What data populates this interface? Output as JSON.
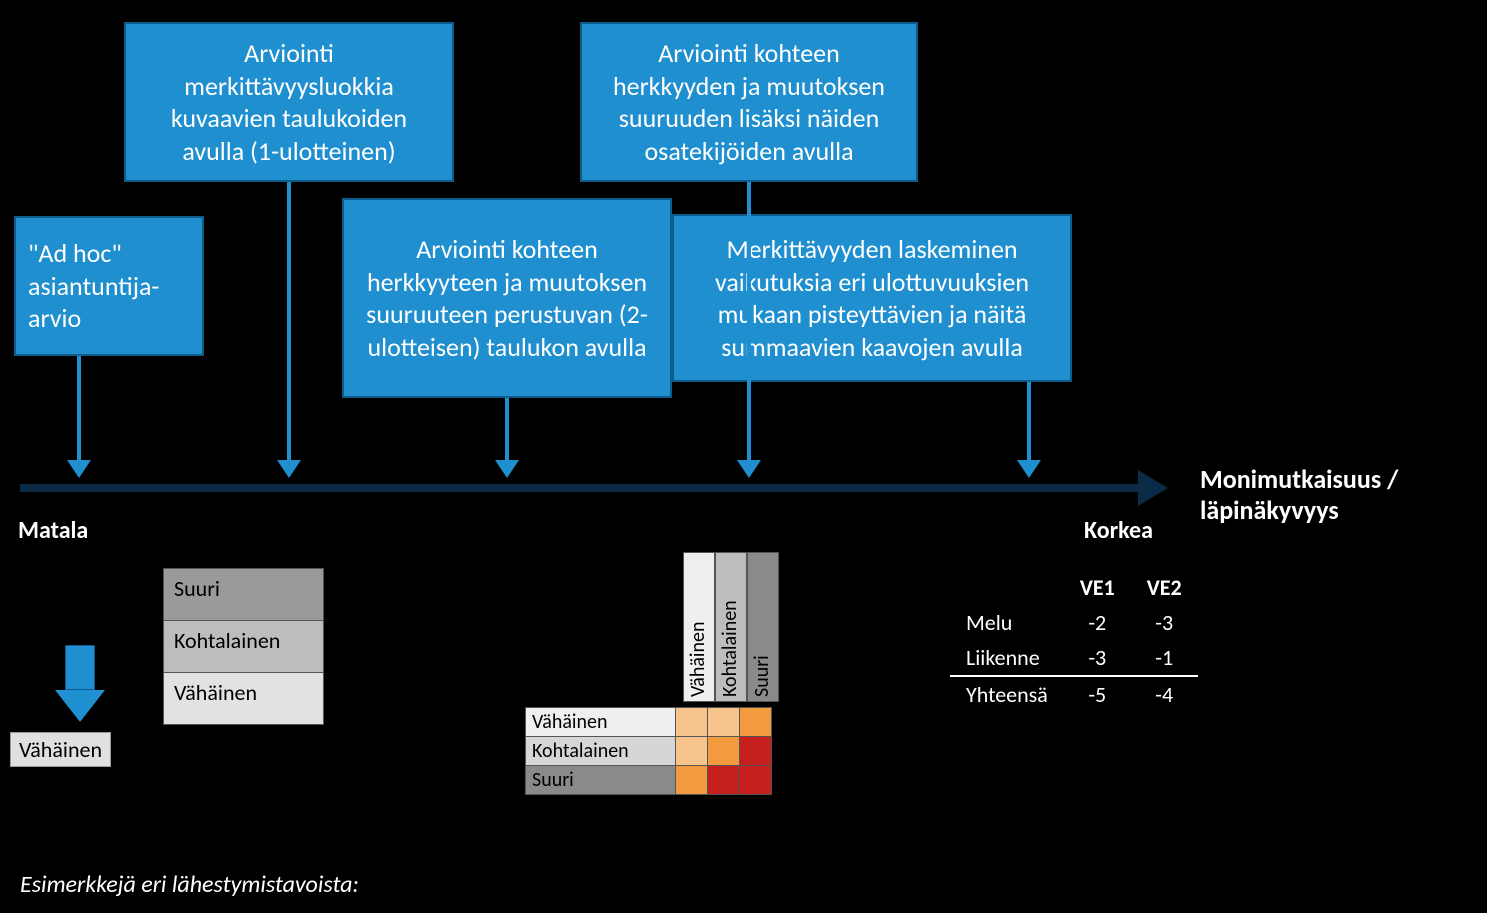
{
  "axis": {
    "low": "Matala",
    "high": "Korkea",
    "complexity_line1": "Monimutkaisuus /",
    "complexity_line2": "läpinäkyvyys"
  },
  "boxes": {
    "b1": "\"Ad hoc\"\nasiantuntija-\narvio",
    "b2": "Arviointi merkittävyysluokkia kuvaavien taulukoiden avulla (1-ulotteinen)",
    "b3": "Arviointi kohteen herkkyyteen ja muutoksen suuruuteen perustuvan (2-ulotteisen) taulukon avulla",
    "b4": "Arviointi kohteen herkkyyden ja muutoksen suuruuden lisäksi näiden osatekijöiden avulla",
    "b5": "Merkittävyyden laskeminen vaikutuksia eri ulottuvuuksien mukaan pisteyttävien ja näitä summaavien kaavojen avulla"
  },
  "illus": {
    "tag": "Vähäinen",
    "list": {
      "r1": "Suuri",
      "r2": "Kohtalainen",
      "r3": "Vähäinen"
    },
    "matrix": {
      "col1": "Vähäinen",
      "col2": "Kohtalainen",
      "col3": "Suuri",
      "row1": "Vähäinen",
      "row2": "Kohtalainen",
      "row3": "Suuri"
    },
    "score": {
      "h1": "VE1",
      "h2": "VE2",
      "rows": [
        {
          "label": "Melu",
          "v1": "-2",
          "v2": "-3"
        },
        {
          "label": "Liikenne",
          "v1": "-3",
          "v2": "-1"
        },
        {
          "label": "Yhteensä",
          "v1": "-5",
          "v2": "-4"
        }
      ]
    },
    "label": "Esimerkkejä eri lähestymistavoista:"
  }
}
